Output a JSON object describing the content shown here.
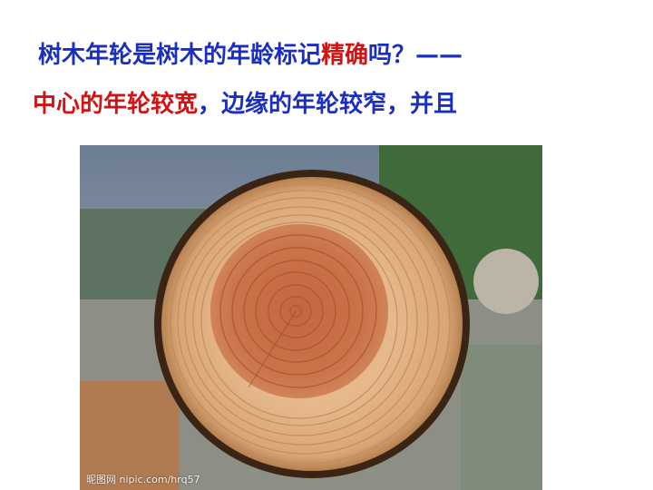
{
  "heading": {
    "line1": {
      "part1": "树木年轮是树木的年龄标记",
      "part2": "精确",
      "part3": "吗？——"
    },
    "line2": {
      "part1": "中心的年轮较宽",
      "part2": "，边缘的年轮较窄，并且"
    }
  },
  "photo": {
    "subject": "tree-trunk-cross-section",
    "watermark": "昵图网 nipic.com/hrq57"
  },
  "colors": {
    "blue_text": "#1b2fbf",
    "red_text": "#d11313"
  }
}
